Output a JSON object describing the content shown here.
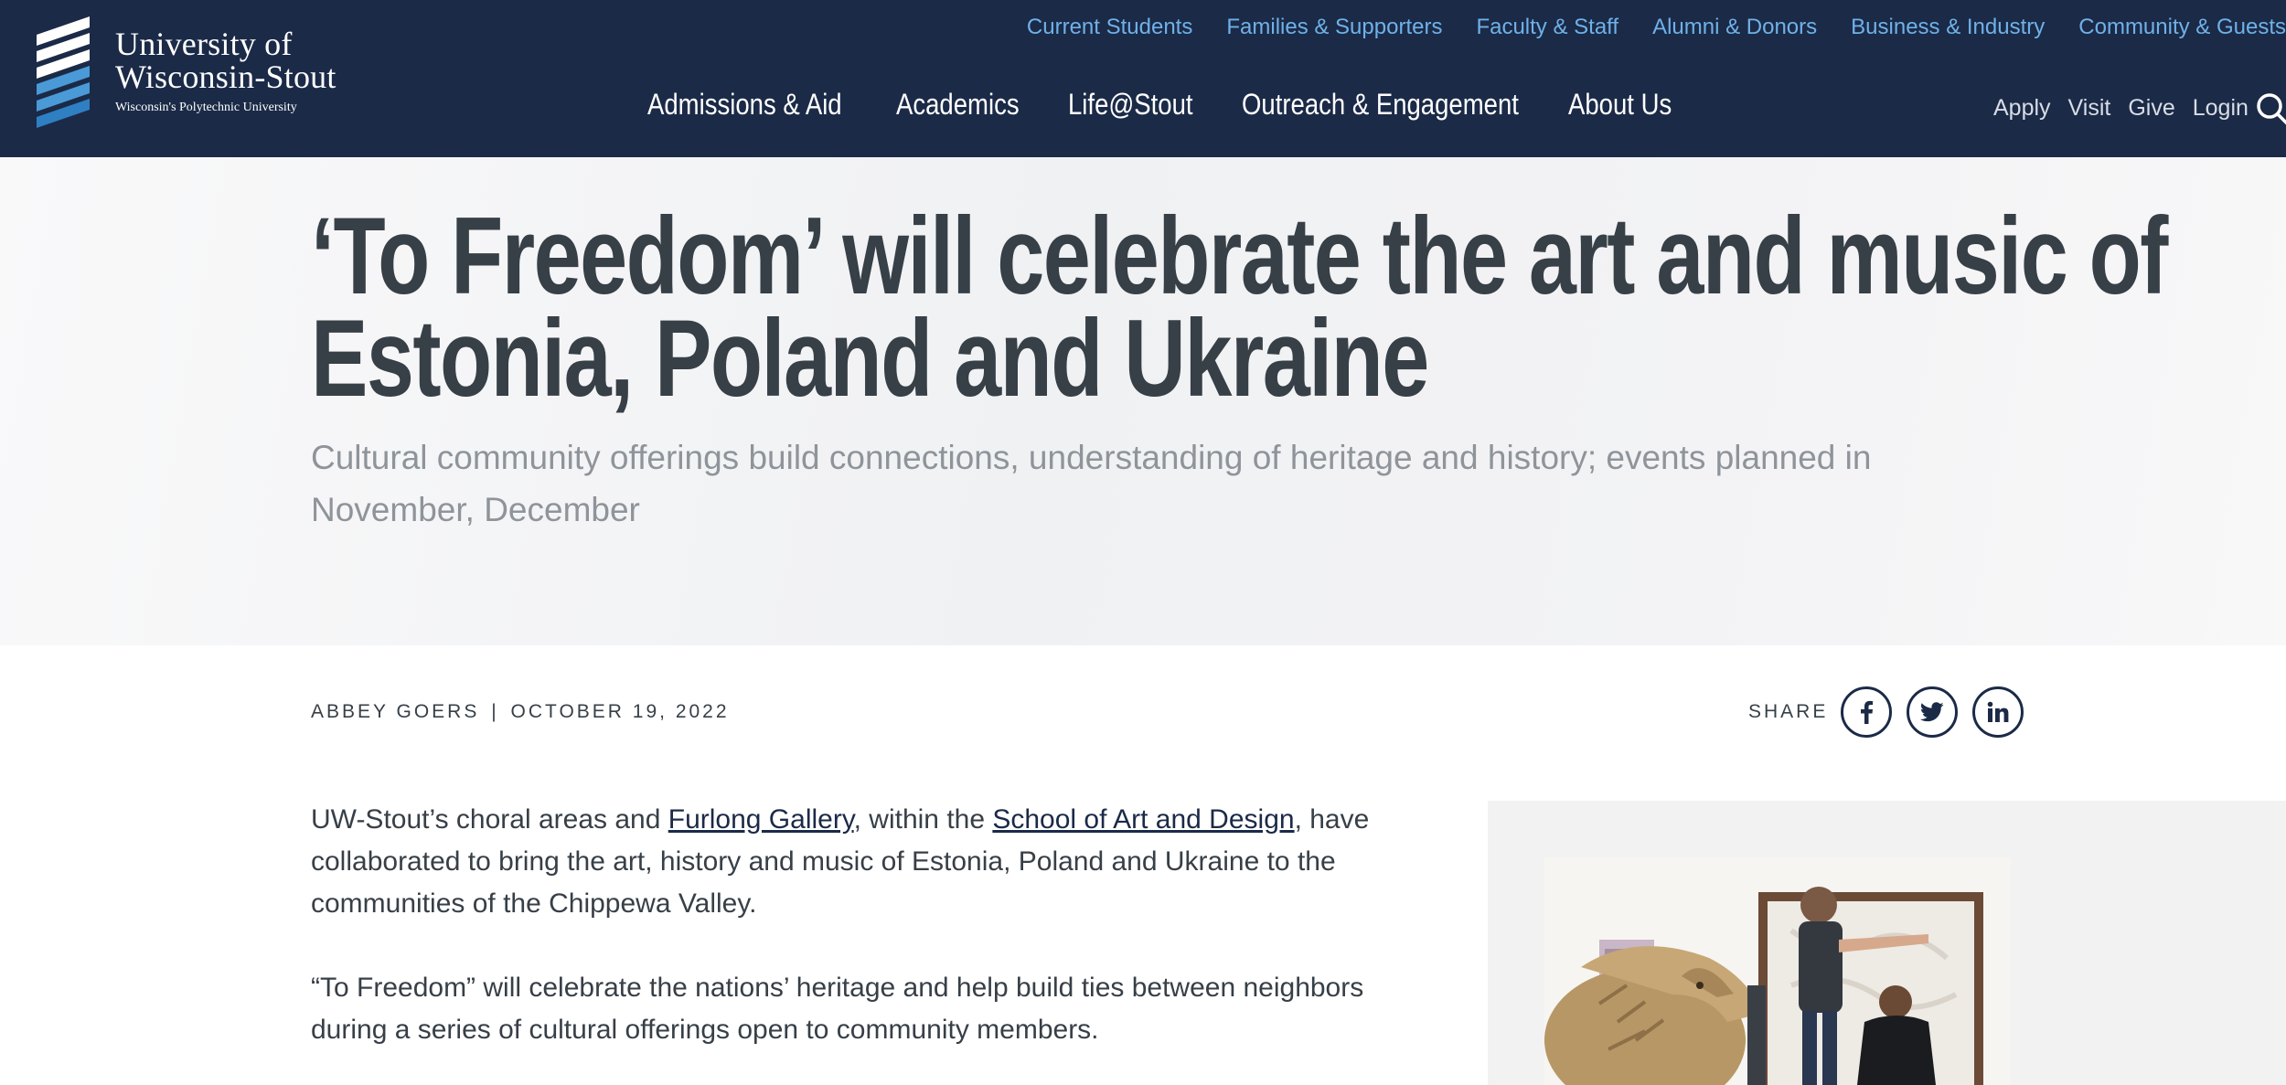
{
  "header": {
    "logo": {
      "line1": "University of",
      "line2": "Wisconsin-Stout",
      "tagline": "Wisconsin's Polytechnic University"
    },
    "utility_nav": [
      "Current Students",
      "Families & Supporters",
      "Faculty & Staff",
      "Alumni & Donors",
      "Business & Industry",
      "Community & Guests"
    ],
    "main_nav": [
      "Admissions & Aid",
      "Academics",
      "Life@Stout",
      "Outreach & Engagement",
      "About Us"
    ],
    "action_nav": [
      "Apply",
      "Visit",
      "Give",
      "Login"
    ],
    "search_icon": "search-icon"
  },
  "hero": {
    "title_line1": "‘To Freedom’ will celebrate the art and music of",
    "title_line2": "Estonia, Poland and Ukraine",
    "subtitle": "Cultural community offerings build connections, understanding of heritage and history; events planned in November, December"
  },
  "byline": {
    "author": "ABBEY GOERS",
    "separator": "|",
    "date": "OCTOBER 19, 2022"
  },
  "share": {
    "label": "SHARE",
    "icons": [
      "facebook-icon",
      "twitter-icon",
      "linkedin-icon"
    ]
  },
  "article": {
    "p1_before": "UW-Stout’s choral areas and ",
    "p1_link1": "Furlong Gallery",
    "p1_middle": ", within the ",
    "p1_link2": "School of Art and Design",
    "p1_after": ", have collaborated to bring the art, history and music of Estonia, Poland and Ukraine to the communities of the Chippewa Valley.",
    "p2": "“To Freedom” will celebrate the nations’ heritage and help build ties between neighbors during a series of cultural offerings open to community members."
  },
  "colors": {
    "header_bg": "#1b2a47",
    "utility_link": "#6fb1e8",
    "title_text": "#373f47",
    "subtitle_text": "#8e949a"
  }
}
